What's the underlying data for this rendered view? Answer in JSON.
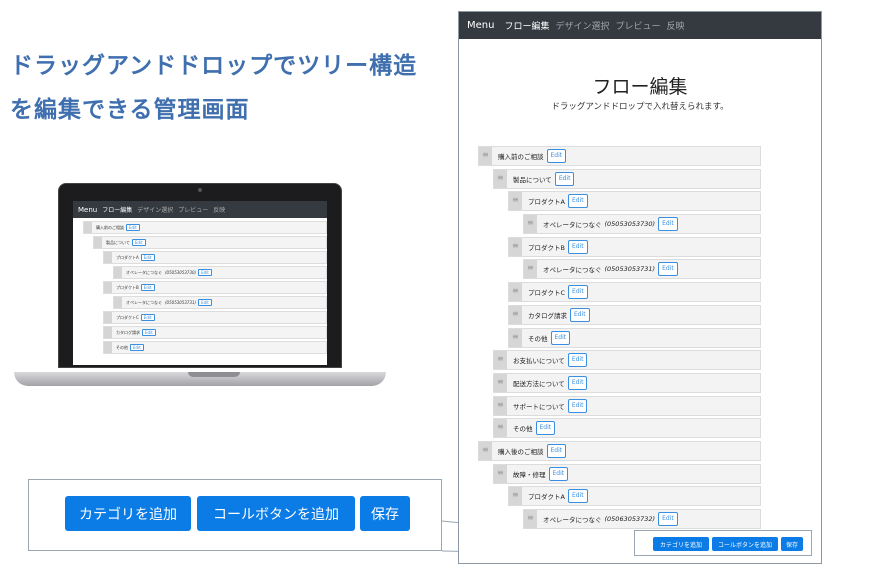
{
  "headline": {
    "line1": "ドラッグアンドドロップでツリー構造",
    "line2": "を編集できる管理画面"
  },
  "nav": {
    "brand": "Menu",
    "items": [
      "フロー編集",
      "デザイン選択",
      "プレビュー",
      "反映"
    ]
  },
  "page": {
    "title": "フロー編集",
    "subtitle": "ドラッグアンドドロップで入れ替えられます。"
  },
  "edit_label": "Edit",
  "tree": [
    {
      "level": 0,
      "label": "購入前のご相談",
      "phone": ""
    },
    {
      "level": 1,
      "label": "製品について",
      "phone": ""
    },
    {
      "level": 2,
      "label": "プロダクトA",
      "phone": ""
    },
    {
      "level": 3,
      "label": "オペレータにつなぐ",
      "phone": "(05053053730)"
    },
    {
      "level": 2,
      "label": "プロダクトB",
      "phone": ""
    },
    {
      "level": 3,
      "label": "オペレータにつなぐ",
      "phone": "(05053053731)"
    },
    {
      "level": 2,
      "label": "プロダクトC",
      "phone": ""
    },
    {
      "level": 2,
      "label": "カタログ請求",
      "phone": ""
    },
    {
      "level": 2,
      "label": "その他",
      "phone": ""
    },
    {
      "level": 1,
      "label": "お支払いについて",
      "phone": ""
    },
    {
      "level": 1,
      "label": "配送方法について",
      "phone": ""
    },
    {
      "level": 1,
      "label": "サポートについて",
      "phone": ""
    },
    {
      "level": 1,
      "label": "その他",
      "phone": ""
    },
    {
      "level": 0,
      "label": "購入後のご相談",
      "phone": ""
    },
    {
      "level": 1,
      "label": "故障・修理",
      "phone": ""
    },
    {
      "level": 2,
      "label": "プロダクトA",
      "phone": ""
    },
    {
      "level": 3,
      "label": "オペレータにつなぐ",
      "phone": "(05063053732)"
    }
  ],
  "mini_tree": [
    {
      "level": 0,
      "label": "購入前のご相談",
      "phone": ""
    },
    {
      "level": 1,
      "label": "製品について",
      "phone": ""
    },
    {
      "level": 2,
      "label": "プロダクトA",
      "phone": ""
    },
    {
      "level": 3,
      "label": "オペレータにつなぐ",
      "phone": "(05053053730)"
    },
    {
      "level": 2,
      "label": "プロダクトB",
      "phone": ""
    },
    {
      "level": 3,
      "label": "オペレータにつなぐ",
      "phone": "(05053053731)"
    },
    {
      "level": 2,
      "label": "プロダクトC",
      "phone": ""
    },
    {
      "level": 2,
      "label": "カタログ請求",
      "phone": ""
    },
    {
      "level": 2,
      "label": "その他",
      "phone": ""
    }
  ],
  "buttons": {
    "add_category": "カテゴリを追加",
    "add_call_button": "コールボタンを追加",
    "save": "保存"
  },
  "colors": {
    "headline": "#3f6fae",
    "primary": "#0b7ce6",
    "navbar": "#343a40"
  }
}
